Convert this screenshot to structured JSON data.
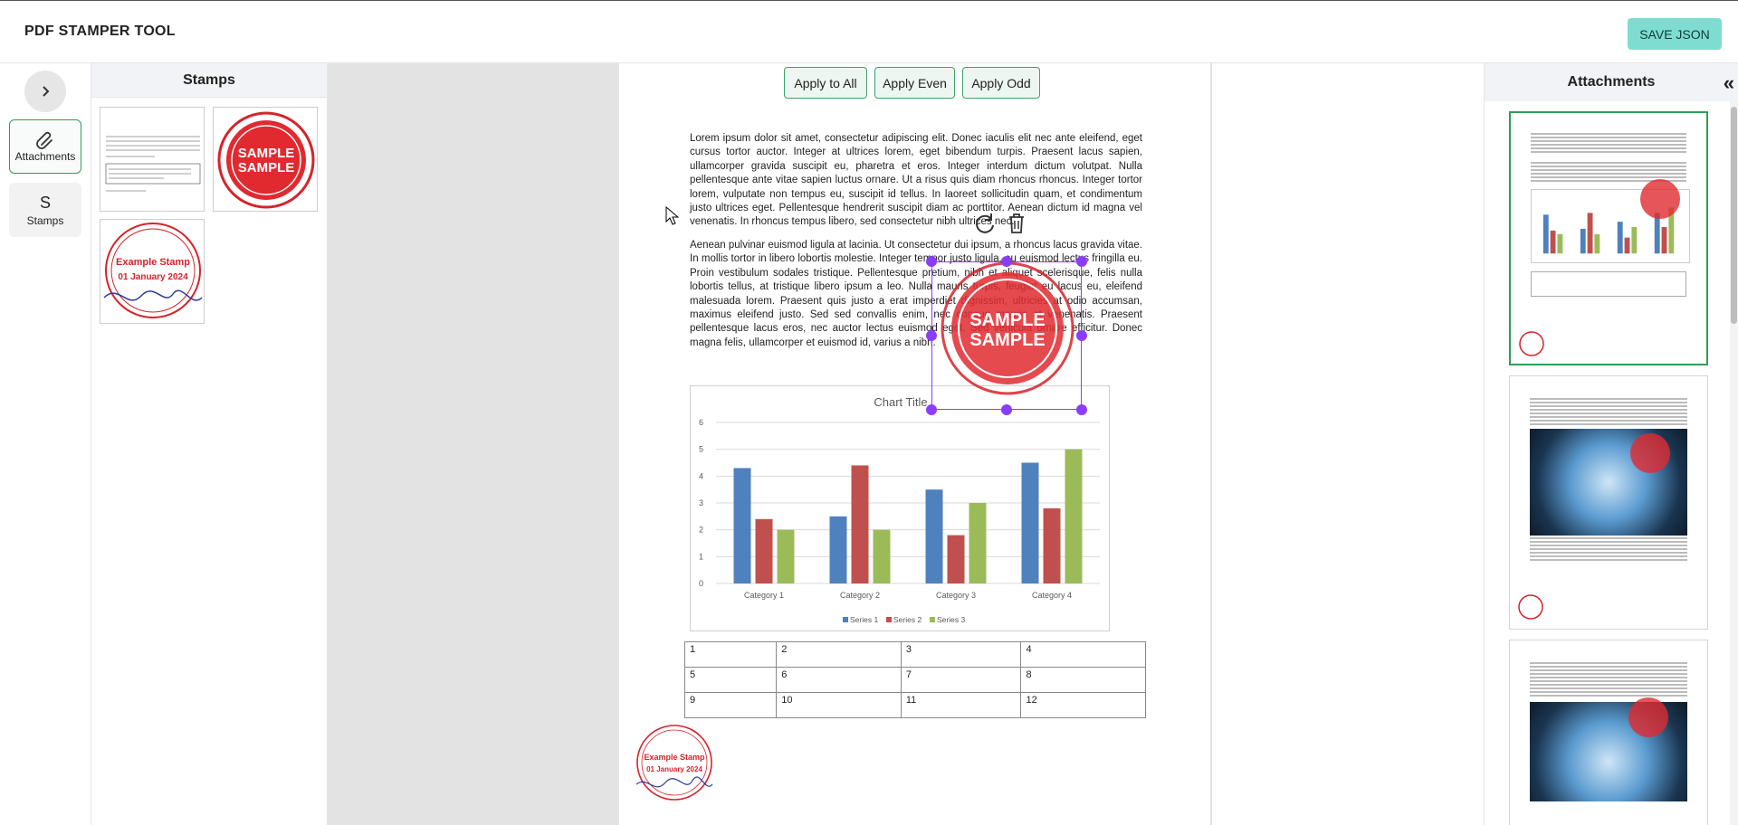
{
  "app": {
    "title": "PDF STAMPER TOOL",
    "save_label": "SAVE JSON"
  },
  "rail": {
    "attachments_label": "Attachments",
    "stamps_letter": "S",
    "stamps_label": "Stamps"
  },
  "stamps_panel": {
    "title": "Stamps",
    "stamps": [
      {
        "kind": "text-document"
      },
      {
        "kind": "sample-seal",
        "line1": "SAMPLE",
        "line2": "SAMPLE"
      },
      {
        "kind": "date-stamp",
        "line1": "Example Stamp",
        "line2": "01 January 2024"
      }
    ]
  },
  "apply": {
    "all": "Apply to All",
    "even": "Apply Even",
    "odd": "Apply Odd"
  },
  "document": {
    "para1": "Lorem ipsum dolor sit amet, consectetur adipiscing elit. Donec iaculis elit nec ante eleifend, eget cursus tortor auctor. Integer at ultrices lorem, eget bibendum turpis. Praesent lacus sapien, ullamcorper gravida suscipit eu, pharetra et eros. Integer interdum dictum volutpat. Nulla pellentesque ante vitae sapien luctus ornare. Ut a risus quis diam rhoncus rhoncus. Integer tortor lorem, vulputate non tempus eu, suscipit id tellus. In laoreet sollicitudin quam, et condimentum justo ultrices eget. Pellentesque hendrerit suscipit diam ac porttitor. Aenean dictum id magna vel venenatis. In rhoncus tempus libero, sed consectetur nibh ultrices nec.",
    "para2": "Aenean pulvinar euismod ligula at lacinia. Ut consectetur dui ipsum, a rhoncus lacus gravida vitae. In mollis tortor in libero lobortis molestie. Integer tempor justo ligula, eu euismod lectus fringilla eu. Proin vestibulum sodales tristique. Pellentesque pretium, nibh et aliquet scelerisque, felis nulla lobortis tellus, at tristique libero ipsum a leo. Nulla mauris turpis, feugiat eu lacus eu, eleifend malesuada lorem. Praesent quis justo a erat imperdiet dignissim, ultricies at odio accumsan, maximus eleifend justo. Sed sed convallis enim, nec congue mauris at venenatis. Praesent pellentesque lacus eros, nec auctor lectus euismod eget. Sed vehicula ornare efficitur. Donec magna felis, ullamcorper et euismod id, varius a nibh.",
    "table": [
      [
        "1",
        "2",
        "3",
        "4"
      ],
      [
        "5",
        "6",
        "7",
        "8"
      ],
      [
        "9",
        "10",
        "11",
        "12"
      ]
    ],
    "placed_stamp": {
      "line1": "SAMPLE",
      "line2": "SAMPLE"
    },
    "page_stamp": {
      "line1": "Example Stamp",
      "line2": "01 January 2024"
    }
  },
  "chart_data": {
    "type": "bar",
    "title": "Chart Title",
    "categories": [
      "Category 1",
      "Category 2",
      "Category 3",
      "Category 4"
    ],
    "series": [
      {
        "name": "Series 1",
        "color": "#4f81bd",
        "values": [
          4.3,
          2.5,
          3.5,
          4.5
        ]
      },
      {
        "name": "Series 2",
        "color": "#c0504d",
        "values": [
          2.4,
          4.4,
          1.8,
          2.8
        ]
      },
      {
        "name": "Series 3",
        "color": "#9bbb59",
        "values": [
          2,
          2,
          3,
          5
        ]
      }
    ],
    "ylim": [
      0,
      6
    ],
    "yticks": [
      0,
      1,
      2,
      3,
      4,
      5,
      6
    ],
    "grid": true,
    "legend": "bottom"
  },
  "attachments": {
    "title": "Attachments",
    "pages": [
      {
        "page": 1,
        "selected": true
      },
      {
        "page": 2,
        "selected": false
      },
      {
        "page": 3,
        "selected": false
      }
    ]
  },
  "colors": {
    "accent": "#8b3dff",
    "green": "#2e9e56",
    "save": "#7fdcd0",
    "stamp_red": "#d6232b"
  }
}
